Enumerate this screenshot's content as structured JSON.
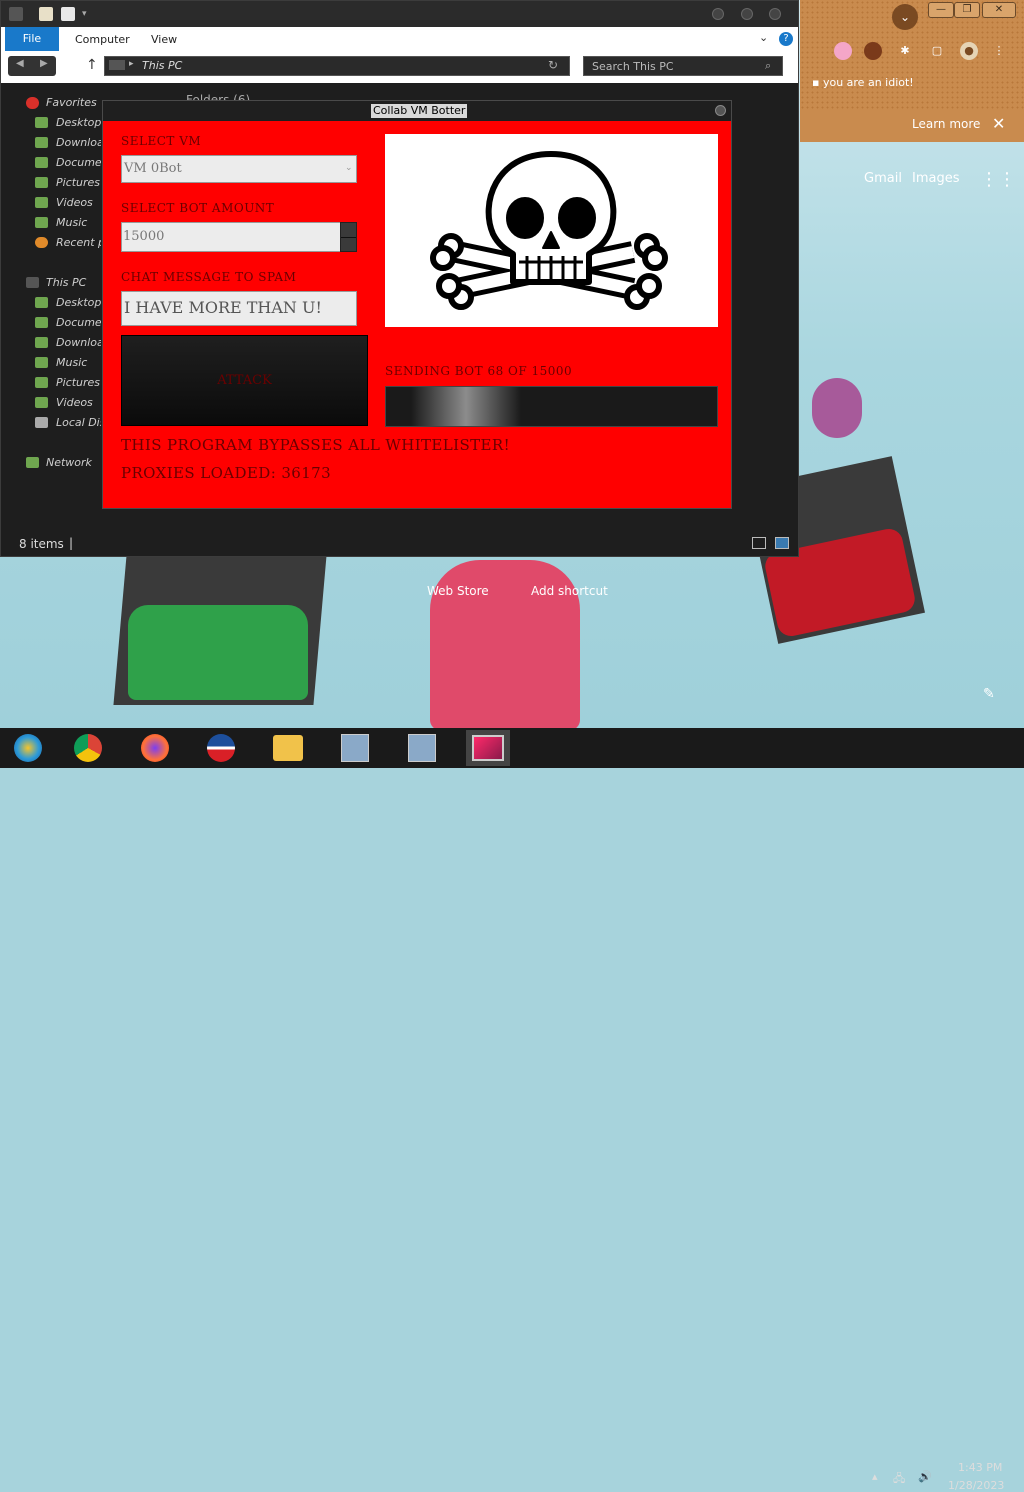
{
  "browser": {
    "bookmark": "you are an idiot!",
    "banner_link": "Learn more",
    "header_links": [
      "Gmail",
      "Images"
    ],
    "shortcuts": [
      "Web Store",
      "Add shortcut"
    ]
  },
  "explorer": {
    "ribbon_tabs": [
      "File",
      "Computer",
      "View"
    ],
    "address": "This PC",
    "search_placeholder": "Search This PC",
    "folders_header": "Folders (6)",
    "favorites": {
      "label": "Favorites",
      "items": [
        "Desktop",
        "Downloads",
        "Documents",
        "Pictures",
        "Videos",
        "Music",
        "Recent places"
      ]
    },
    "this_pc": {
      "label": "This PC",
      "items": [
        "Desktop",
        "Documents",
        "Downloads",
        "Music",
        "Pictures",
        "Videos",
        "Local Disk"
      ]
    },
    "network_label": "Network",
    "status_items": "8 items"
  },
  "botter": {
    "title": "Collab VM Botter",
    "select_vm_label": "SELECT VM",
    "vm_value": "VM 0Bot",
    "bot_amount_label": "SELECT BOT AMOUNT",
    "bot_amount": "15000",
    "chat_label": "CHAT MESSAGE TO SPAM",
    "chat_message": "I HAVE MORE THAN U!",
    "attack_label": "ATTACK",
    "sending_status": "SENDING BOT 68 OF 15000",
    "progress_fraction": 0.0045,
    "bypass_text": "THIS PROGRAM BYPASSES ALL WHITELISTER!",
    "proxies_text": "PROXIES LOADED: 36173",
    "image_icon": "skull-and-crossbones-icon"
  },
  "taskbar": {
    "apps": [
      "start-orb-icon",
      "chrome-icon",
      "firefox-icon",
      "browser-icon",
      "file-explorer-icon",
      "network-setup-icon",
      "network-setup-icon",
      "monitor-app-icon"
    ],
    "time": "1:43 PM",
    "date": "1/28/2023"
  }
}
